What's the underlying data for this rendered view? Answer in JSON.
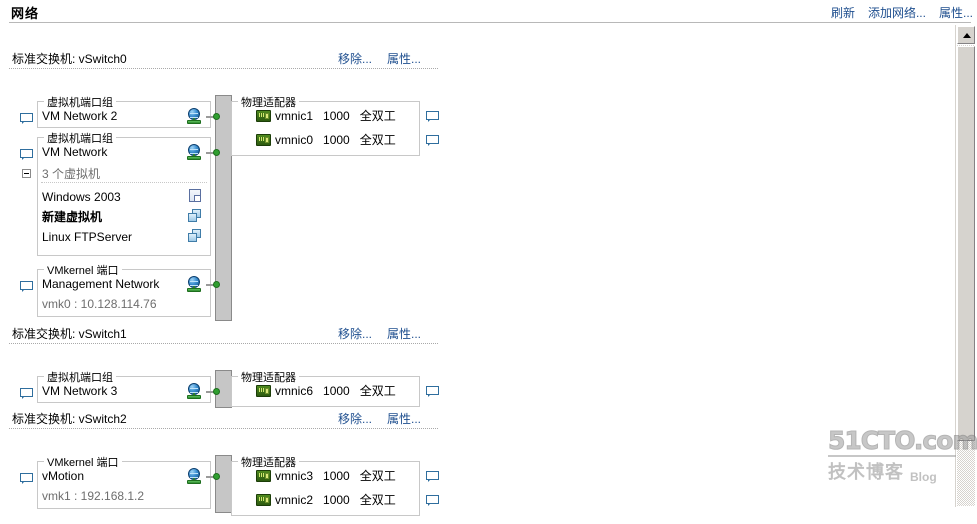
{
  "header": {
    "title": "网络",
    "links": [
      {
        "label": "刷新",
        "name": "refresh-link"
      },
      {
        "label": "添加网络...",
        "name": "add-network-link"
      },
      {
        "label": "属性...",
        "name": "properties-link"
      }
    ]
  },
  "labels": {
    "vm_port_group": "虚拟机端口组",
    "vmkernel_port": "VMkernel 端口",
    "physical_adapters": "物理适配器",
    "remove": "移除...",
    "properties": "属性..."
  },
  "switches": [
    {
      "title": "标准交换机: vSwitch0",
      "groups": [
        {
          "legend": "虚拟机端口组",
          "network": "VM Network 2"
        },
        {
          "legend": "虚拟机端口组",
          "network": "VM Network",
          "vm_count_label": "3 个虚拟机",
          "vms": [
            {
              "name": "Windows 2003",
              "icon": "doc-icon"
            },
            {
              "name": "新建虚拟机",
              "icon": "vm-icon"
            },
            {
              "name": "Linux FTPServer",
              "icon": "vm-icon"
            }
          ]
        },
        {
          "legend": "VMkernel 端口",
          "network": "Management Network",
          "detail": "vmk0 : 10.128.114.76"
        }
      ],
      "adapters": [
        {
          "name": "vmnic1",
          "speed": "1000",
          "duplex": "全双工"
        },
        {
          "name": "vmnic0",
          "speed": "1000",
          "duplex": "全双工"
        }
      ]
    },
    {
      "title": "标准交换机: vSwitch1",
      "groups": [
        {
          "legend": "虚拟机端口组",
          "network": "VM Network 3"
        }
      ],
      "adapters": [
        {
          "name": "vmnic6",
          "speed": "1000",
          "duplex": "全双工"
        }
      ]
    },
    {
      "title": "标准交换机: vSwitch2",
      "groups": [
        {
          "legend": "VMkernel 端口",
          "network": "vMotion",
          "detail": "vmk1 : 192.168.1.2"
        }
      ],
      "adapters": [
        {
          "name": "vmnic3",
          "speed": "1000",
          "duplex": "全双工"
        },
        {
          "name": "vmnic2",
          "speed": "1000",
          "duplex": "全双工"
        }
      ]
    }
  ],
  "watermark": {
    "line1": "51CTO.com",
    "line2": "技术博客",
    "line3": "Blog"
  },
  "colors": {
    "link": "#1f4f8f",
    "connector_dot": "#2f9e2f",
    "switch_bar": "#c6c6c6",
    "group_border": "#c8c8c8",
    "dim_text": "#6e6e6e"
  }
}
